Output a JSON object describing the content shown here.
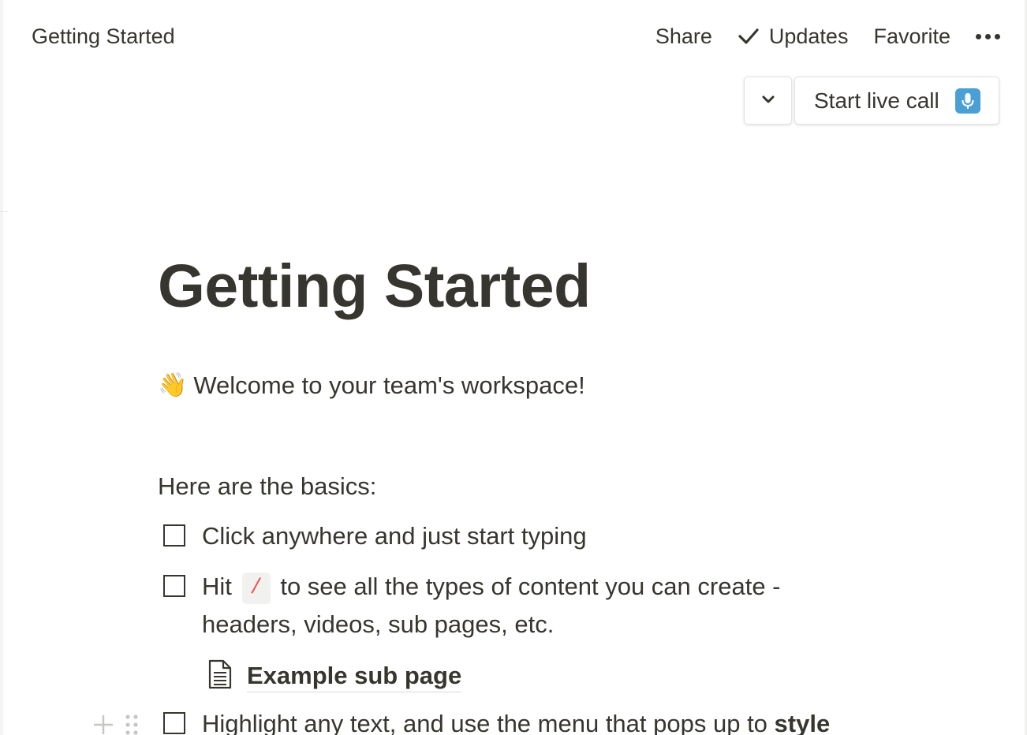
{
  "topbar": {
    "title": "Getting Started",
    "actions": {
      "share": "Share",
      "updates": "Updates",
      "favorite": "Favorite"
    },
    "icons": {
      "updates": "check-icon",
      "more": "more-icon"
    }
  },
  "live_call": {
    "label": "Start live call",
    "dropdown_icon": "chevron-down-icon",
    "mic_icon": "microphone-icon",
    "accent_color": "#4a9fd5"
  },
  "document": {
    "title": "Getting Started",
    "welcome_emoji": "👋",
    "welcome": "Welcome to your team's workspace!",
    "basics_heading": "Here are the basics:",
    "todos": [
      {
        "text": "Click anywhere and just start typing",
        "checked": false
      },
      {
        "text_before": "Hit",
        "code": "/",
        "text_after": "to see all the types of content you can create -",
        "text_line2": "headers, videos, sub pages, etc.",
        "checked": false
      },
      {
        "text": "Highlight any text, and use the menu that pops up to",
        "text_bold": "style",
        "checked": false
      }
    ],
    "subpage": {
      "label": "Example sub page",
      "icon": "page-icon"
    }
  },
  "colors": {
    "text": "#37352f",
    "code_text": "#eb5757",
    "code_bg": "#f1f1ef"
  }
}
